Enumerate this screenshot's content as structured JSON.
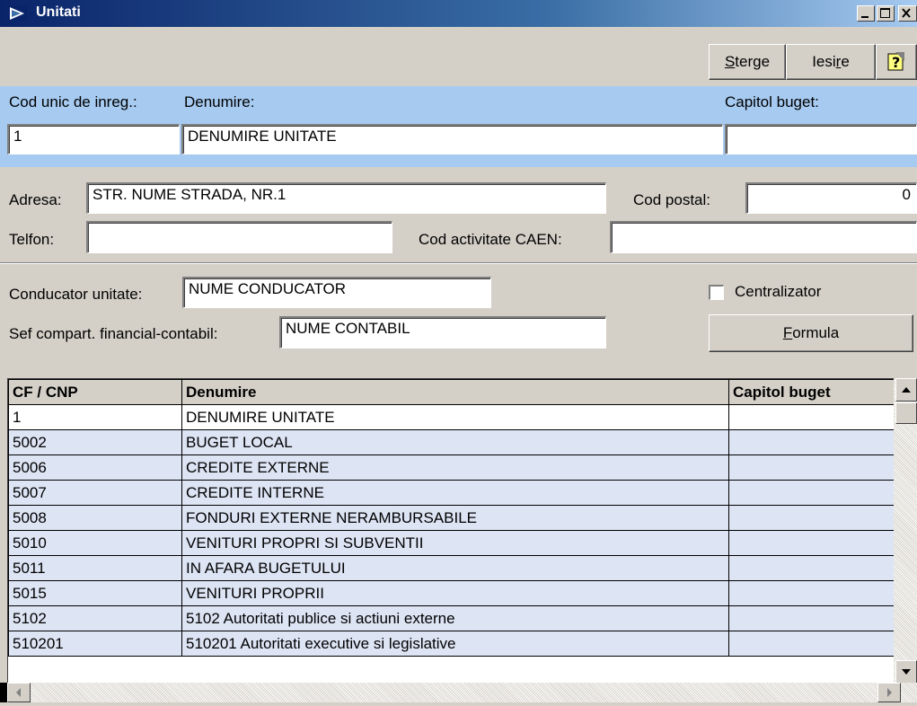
{
  "window": {
    "title": "Unitati"
  },
  "toolbar": {
    "delete_label": "Sterge",
    "delete_accel": "S",
    "delete_rest": "terge",
    "exit_label": "Iesire",
    "exit_pre": "Iesi",
    "exit_accel": "r",
    "exit_post": "e",
    "help_icon": "help-icon"
  },
  "header": {
    "cui_label": "Cod unic de inreg.:",
    "name_label": "Denumire:",
    "budget_label": "Capitol buget:",
    "cui_value": "1",
    "name_value": "DENUMIRE UNITATE",
    "budget_value": ""
  },
  "address": {
    "address_label": "Adresa:",
    "address_value": "STR. NUME STRADA, NR.1",
    "postal_label": "Cod postal:",
    "postal_value": "0",
    "phone_label": "Telfon:",
    "phone_value": "",
    "caen_label": "Cod activitate CAEN:",
    "caen_value": ""
  },
  "management": {
    "leader_label": "Conducator unitate:",
    "leader_value": "NUME CONDUCATOR",
    "accountant_label": "Sef compart. financial-contabil:",
    "accountant_value": "NUME CONTABIL",
    "centralizer_label": "Centralizator",
    "centralizer_checked": false,
    "formula_label": "Formula",
    "formula_accel": "F",
    "formula_rest": "ormula"
  },
  "grid": {
    "columns": [
      "CF / CNP",
      "Denumire",
      "Capitol buget"
    ],
    "rows": [
      {
        "cf": "1",
        "name": "DENUMIRE UNITATE",
        "budget": ""
      },
      {
        "cf": "5002",
        "name": "BUGET LOCAL",
        "budget": ""
      },
      {
        "cf": "5006",
        "name": "CREDITE EXTERNE",
        "budget": ""
      },
      {
        "cf": "5007",
        "name": "CREDITE INTERNE",
        "budget": ""
      },
      {
        "cf": "5008",
        "name": "FONDURI EXTERNE NERAMBURSABILE",
        "budget": ""
      },
      {
        "cf": "5010",
        "name": "VENITURI PROPRI SI SUBVENTII",
        "budget": ""
      },
      {
        "cf": "5011",
        "name": "IN AFARA BUGETULUI",
        "budget": ""
      },
      {
        "cf": "5015",
        "name": "VENITURI PROPRII",
        "budget": ""
      },
      {
        "cf": "5102",
        "name": "5102 Autoritati publice si actiuni externe",
        "budget": ""
      },
      {
        "cf": "510201",
        "name": "510201 Autoritati executive si legislative",
        "budget": ""
      }
    ]
  }
}
